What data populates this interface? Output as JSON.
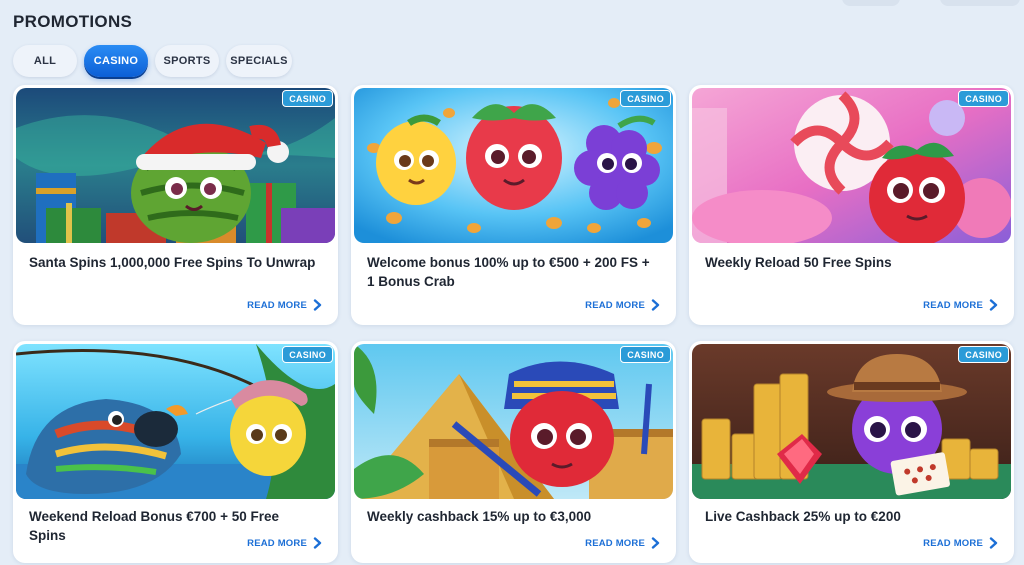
{
  "page": {
    "title": "PROMOTIONS"
  },
  "filters": [
    {
      "label": "ALL",
      "active": false
    },
    {
      "label": "CASINO",
      "active": true
    },
    {
      "label": "SPORTS",
      "active": false
    },
    {
      "label": "SPECIALS",
      "active": false
    }
  ],
  "colors": {
    "accent": "#1c6fd6",
    "active_tab": "#0c5fd6",
    "badge": "#2b9bd8",
    "background": "#e4edf7"
  },
  "promotions": [
    {
      "badge": "CASINO",
      "title": "Santa Spins 1,000,000 Free Spins To Unwrap",
      "cta": "READ MORE",
      "art": "watermelon-santa"
    },
    {
      "badge": "CASINO",
      "title": "Welcome bonus 100% up to €500 + 200 FS + 1 Bonus Crab",
      "cta": "READ MORE",
      "art": "fruit-trio"
    },
    {
      "badge": "CASINO",
      "title": "Weekly Reload 50 Free Spins",
      "cta": "READ MORE",
      "art": "strawberry-candy"
    },
    {
      "badge": "CASINO",
      "title": "Weekend Reload Bonus €700 + 50 Free Spins",
      "cta": "READ MORE",
      "art": "fishing-lemon"
    },
    {
      "badge": "CASINO",
      "title": "Weekly cashback 15% up to €3,000",
      "cta": "READ MORE",
      "art": "pharaoh-strawberry"
    },
    {
      "badge": "CASINO",
      "title": "Live Cashback 25% up to €200",
      "cta": "READ MORE",
      "art": "cowboy-grape"
    }
  ]
}
